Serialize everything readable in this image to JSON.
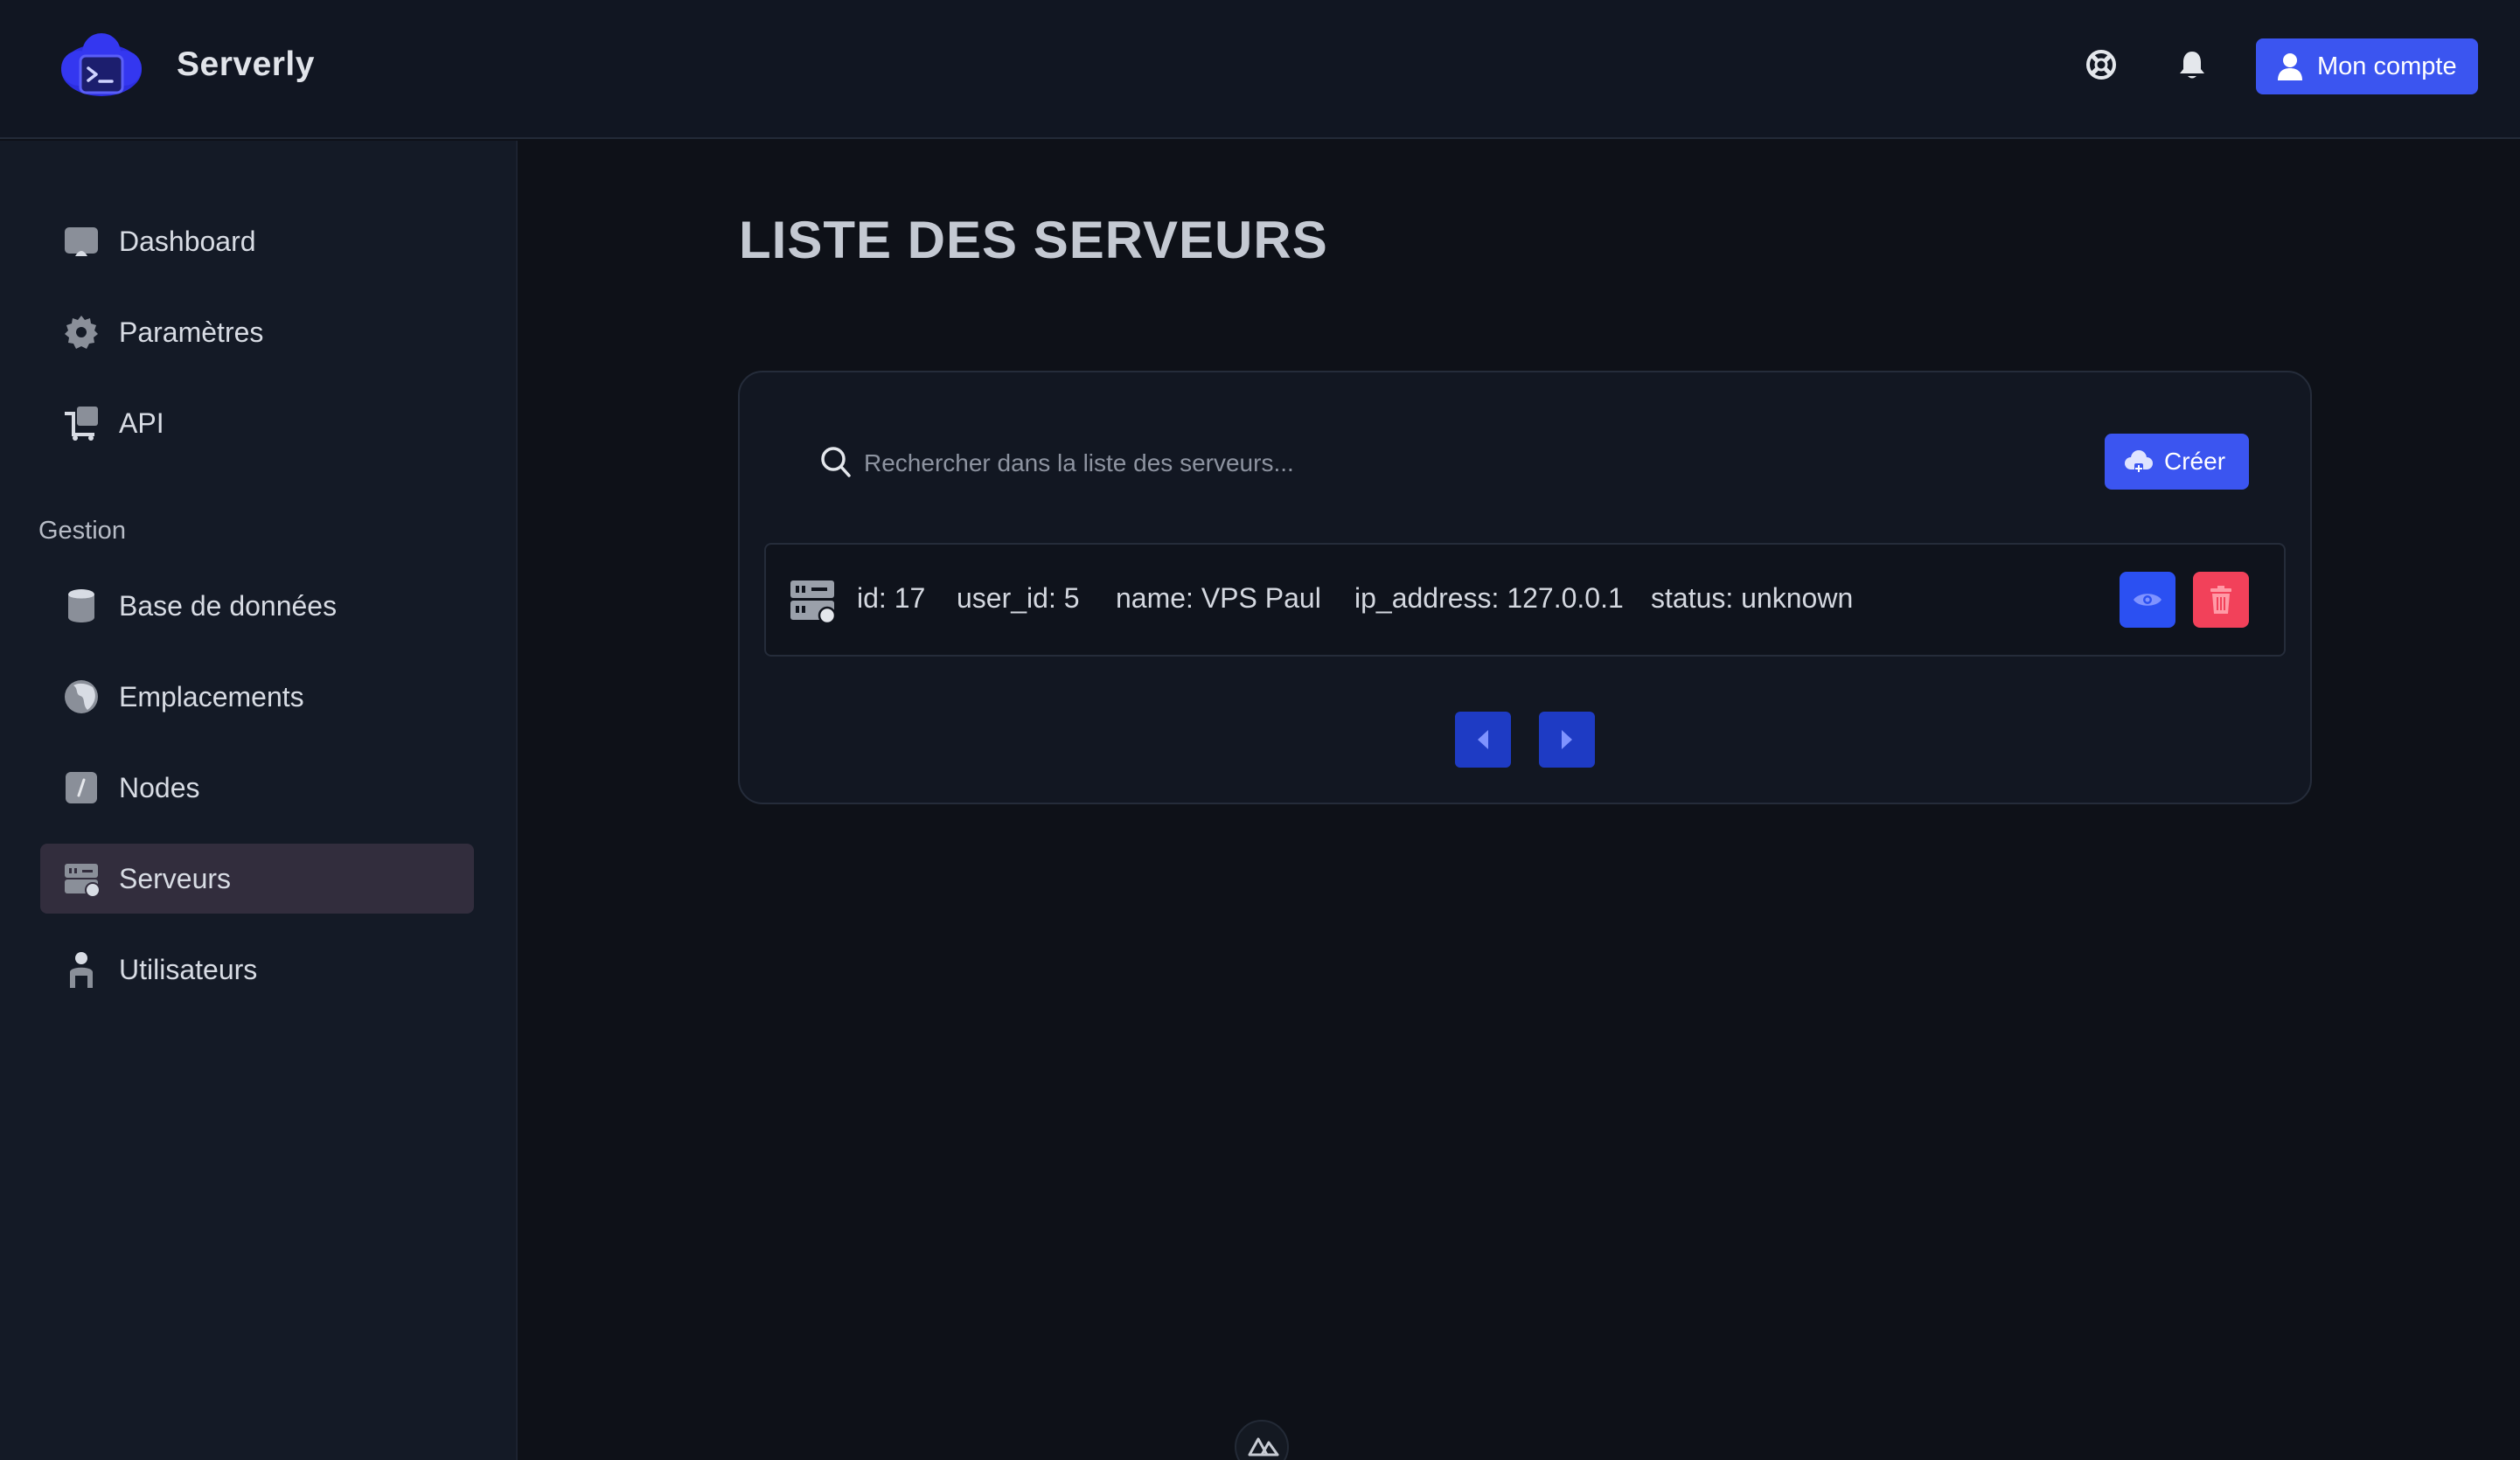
{
  "app": {
    "brand": "Serverly",
    "account_label": "Mon compte"
  },
  "sidebar": {
    "items": [
      {
        "label": "Dashboard",
        "icon": "dashboard-icon"
      },
      {
        "label": "Paramètres",
        "icon": "gear-icon"
      },
      {
        "label": "API",
        "icon": "api-icon"
      }
    ],
    "section_label": "Gestion",
    "manage_items": [
      {
        "label": "Base de données",
        "icon": "database-icon"
      },
      {
        "label": "Emplacements",
        "icon": "globe-icon"
      },
      {
        "label": "Nodes",
        "icon": "nodes-icon"
      },
      {
        "label": "Serveurs",
        "icon": "server-icon",
        "active": true
      },
      {
        "label": "Utilisateurs",
        "icon": "user-icon"
      }
    ]
  },
  "main": {
    "title": "LISTE DES SERVEURS",
    "search_placeholder": "Rechercher dans la liste des serveurs...",
    "create_label": "Créer",
    "rows": [
      {
        "id": "id: 17",
        "user_id": "user_id: 5",
        "name": "name: VPS Paul",
        "ip_address": "ip_address: 127.0.0.1",
        "status": "status: unknown"
      }
    ]
  },
  "colors": {
    "accent": "#3b55f0",
    "danger": "#f2415a",
    "pager": "#1e3bc4",
    "active_nav": "#322d3d"
  }
}
